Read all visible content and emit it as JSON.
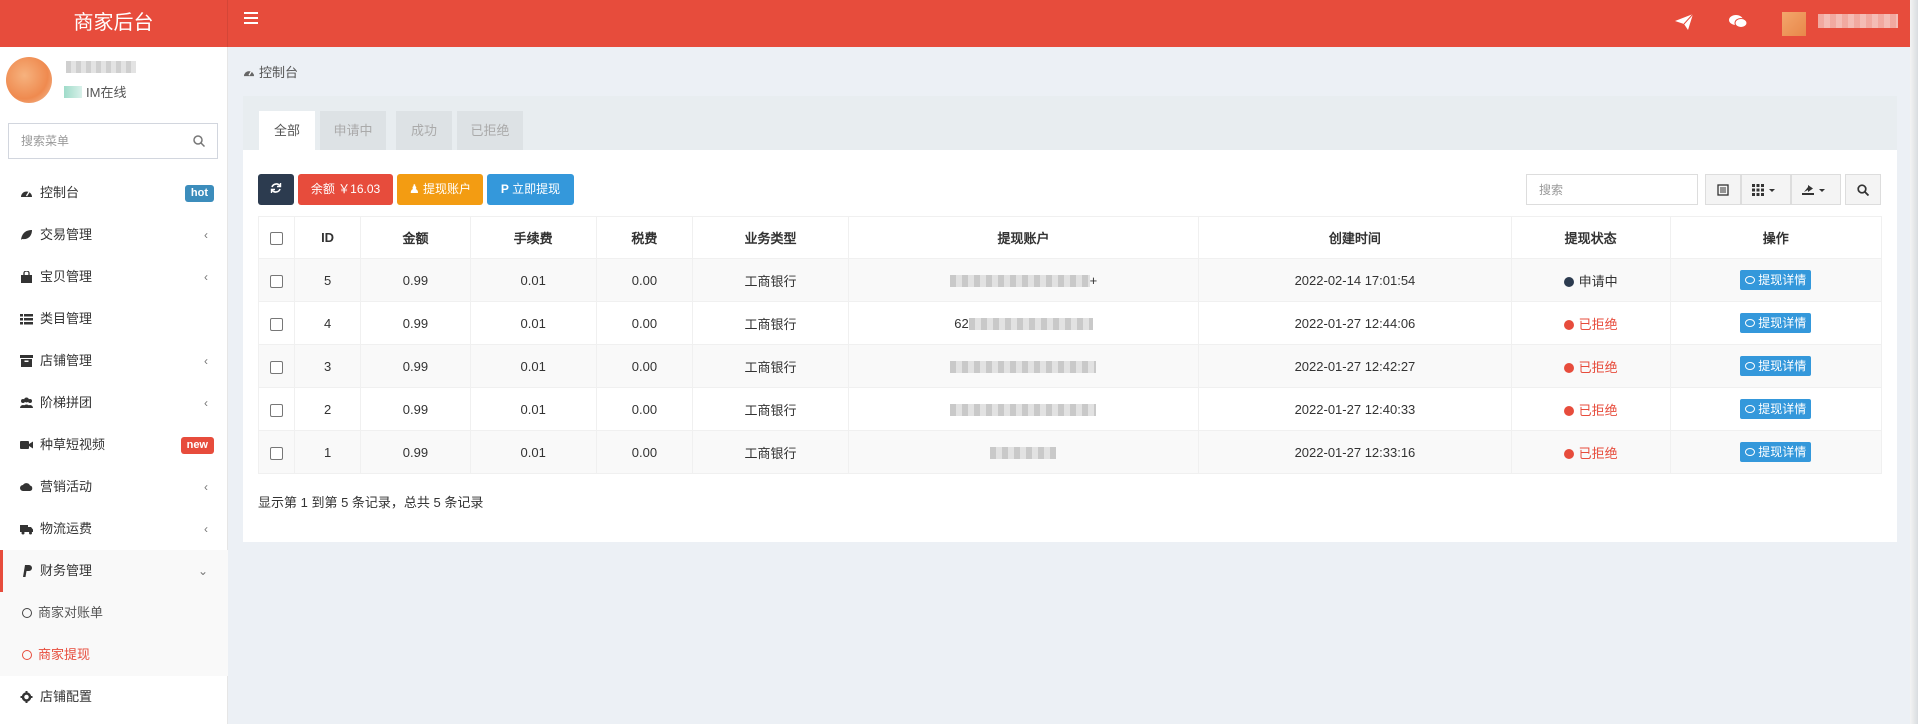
{
  "header": {
    "logo": "商家后台"
  },
  "sidebar": {
    "status_text": "IM在线",
    "search_placeholder": "搜索菜单",
    "items": [
      {
        "label": "控制台",
        "icon": "dashboard-icon",
        "badge": "hot"
      },
      {
        "label": "交易管理",
        "icon": "leaf-icon",
        "caret": "‹"
      },
      {
        "label": "宝贝管理",
        "icon": "shopping-bag-icon",
        "caret": "‹"
      },
      {
        "label": "类目管理",
        "icon": "list-icon"
      },
      {
        "label": "店铺管理",
        "icon": "archive-icon",
        "caret": "‹"
      },
      {
        "label": "阶梯拼团",
        "icon": "users-icon",
        "caret": "‹"
      },
      {
        "label": "种草短视频",
        "icon": "video-camera-icon",
        "badge": "new"
      },
      {
        "label": "营销活动",
        "icon": "cloud-icon",
        "caret": "‹"
      },
      {
        "label": "物流运费",
        "icon": "truck-icon",
        "caret": "‹"
      },
      {
        "label": "财务管理",
        "icon": "paypal-icon",
        "caret": "⌄"
      },
      {
        "label": "店铺配置",
        "icon": "gear-icon"
      }
    ],
    "sub_items": [
      {
        "label": "商家对账单"
      },
      {
        "label": "商家提现"
      }
    ]
  },
  "breadcrumb": "控制台",
  "tabs": [
    "全部",
    "申请中",
    "成功",
    "已拒绝"
  ],
  "toolbar": {
    "balance_label": "余额 ￥16.03",
    "account_label": "提现账户",
    "withdraw_label": "立即提现",
    "search_placeholder": "搜索"
  },
  "table": {
    "columns": [
      "ID",
      "金额",
      "手续费",
      "税费",
      "业务类型",
      "提现账户",
      "创建时间",
      "提现状态",
      "操作"
    ],
    "rows": [
      {
        "id": "5",
        "amount": "0.99",
        "fee": "0.01",
        "tax": "0.00",
        "type": "工商银行",
        "account_tail": "+",
        "created": "2022-02-14 17:01:54",
        "status": "申请中",
        "action": "提现详情"
      },
      {
        "id": "4",
        "amount": "0.99",
        "fee": "0.01",
        "tax": "0.00",
        "type": "工商银行",
        "account_prefix": "62",
        "created": "2022-01-27 12:44:06",
        "status": "已拒绝",
        "action": "提现详情"
      },
      {
        "id": "3",
        "amount": "0.99",
        "fee": "0.01",
        "tax": "0.00",
        "type": "工商银行",
        "created": "2022-01-27 12:42:27",
        "status": "已拒绝",
        "action": "提现详情"
      },
      {
        "id": "2",
        "amount": "0.99",
        "fee": "0.01",
        "tax": "0.00",
        "type": "工商银行",
        "created": "2022-01-27 12:40:33",
        "status": "已拒绝",
        "action": "提现详情"
      },
      {
        "id": "1",
        "amount": "0.99",
        "fee": "0.01",
        "tax": "0.00",
        "type": "工商银行",
        "created": "2022-01-27 12:33:16",
        "status": "已拒绝",
        "action": "提现详情"
      }
    ]
  },
  "pager_text": "显示第 1 到第 5 条记录，总共 5 条记录",
  "colors": {
    "brand": "#e74c3c",
    "pending_dot": "#2c3b4f",
    "rejected": "#e74c3c",
    "info_button": "#3498db",
    "warning_button": "#f39c12"
  }
}
